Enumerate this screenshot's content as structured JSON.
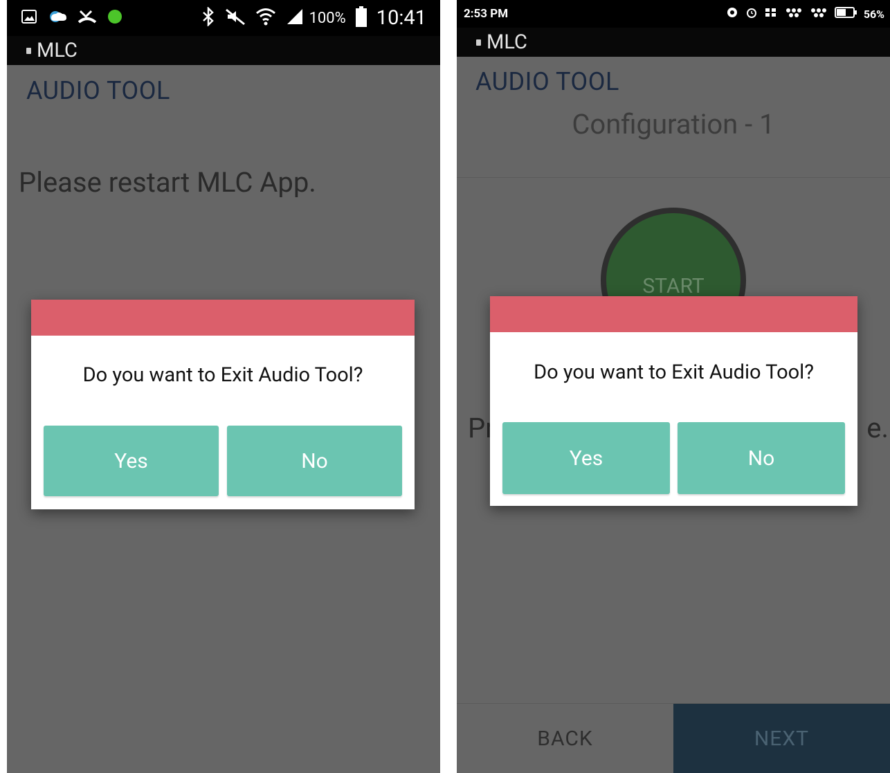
{
  "left_screen": {
    "status_bar": {
      "battery_percent": "100%",
      "time": "10:41",
      "left_icons": [
        "gallery-icon",
        "weather-icon",
        "missed-call-icon",
        "green-dot-icon"
      ],
      "right_icons": [
        "bluetooth-icon",
        "mute-icon",
        "wifi-icon",
        "signal-icon"
      ]
    },
    "app_bar": {
      "app_name": "MLC"
    },
    "title": "AUDIO TOOL",
    "message": "Please restart MLC App.",
    "dialog": {
      "question": "Do you want to Exit Audio Tool?",
      "yes_label": "Yes",
      "no_label": "No"
    }
  },
  "right_screen": {
    "status_bar": {
      "time": "2:53 PM",
      "battery_percent": "56%",
      "right_icons": [
        "app-notification-icon",
        "alarm-icon",
        "app-notification-icon",
        "app-notification-icon",
        "app-notification-icon",
        "battery-icon"
      ]
    },
    "app_bar": {
      "app_name": "MLC"
    },
    "title": "AUDIO TOOL",
    "config_title": "Configuration - 1",
    "start_label": "START",
    "partial_text_left": "Pr",
    "partial_text_right": "e.",
    "dialog": {
      "question": "Do you want to Exit Audio Tool?",
      "yes_label": "Yes",
      "no_label": "No"
    },
    "bottom_nav": {
      "back_label": "BACK",
      "next_label": "NEXT"
    }
  },
  "colors": {
    "dim_background": "#666666",
    "dialog_header": "#db5f6b",
    "dialog_button": "#6bc5b1",
    "start_circle": "#2e5a30",
    "next_button_bg": "#1d3140",
    "title_text": "#1a2840"
  }
}
